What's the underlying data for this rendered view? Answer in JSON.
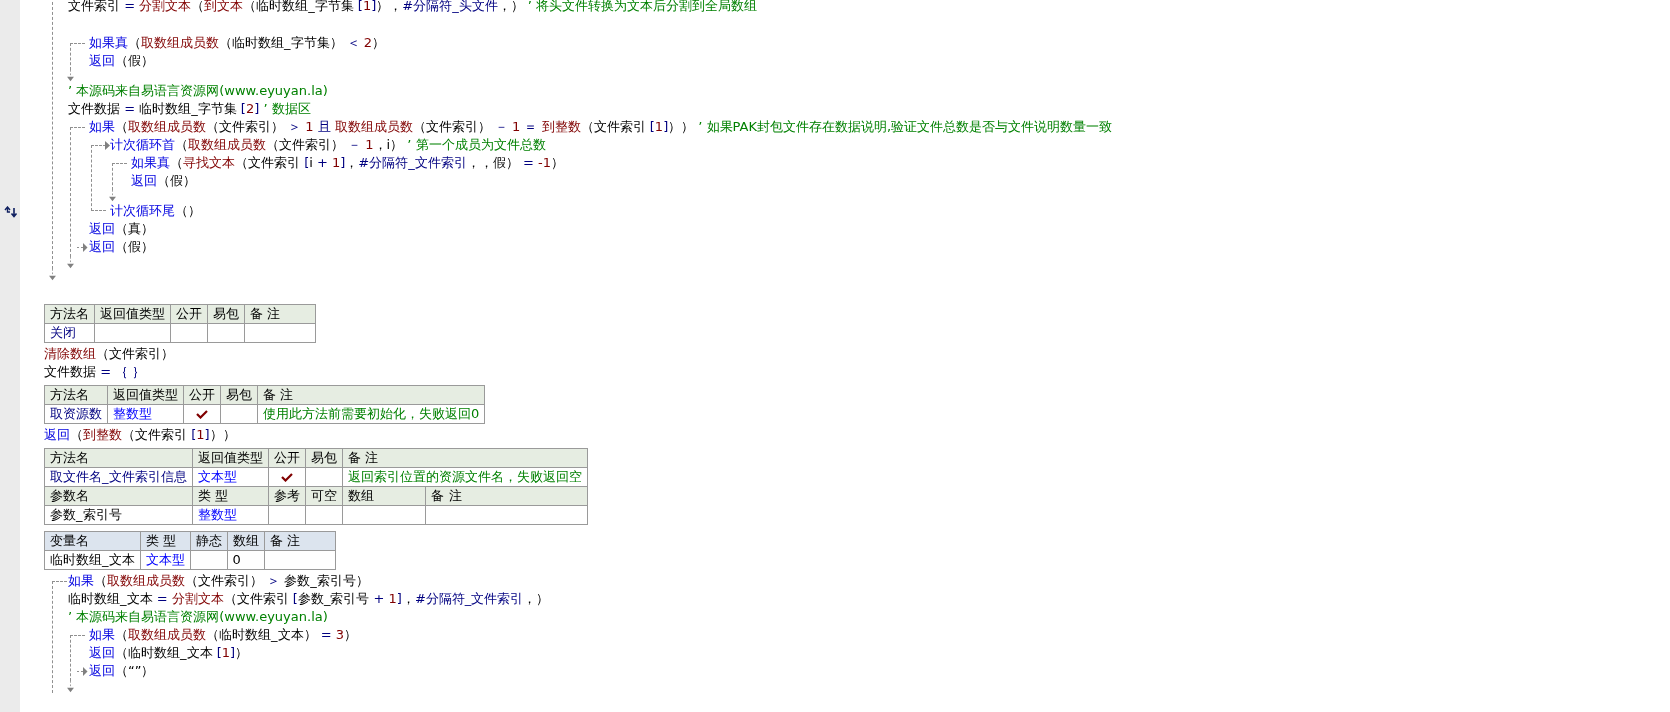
{
  "code": [
    {
      "kind": "body",
      "children": [
        {
          "kind": "line",
          "tokens": [
            {
              "kind": "plain",
              "text": "文件索引 "
            },
            {
              "kind": "op",
              "text": "= "
            },
            {
              "kind": "cmd",
              "text": "分割文本"
            },
            {
              "kind": "plain",
              "text": "（"
            },
            {
              "kind": "cmd",
              "text": "到文本"
            },
            {
              "kind": "plain",
              "text": "（临时数组_字节集 "
            },
            {
              "kind": "op",
              "text": "["
            },
            {
              "kind": "num",
              "text": "1"
            },
            {
              "kind": "op",
              "text": "]"
            },
            {
              "kind": "plain",
              "text": "），"
            },
            {
              "kind": "op",
              "text": "#分隔符_头文件"
            },
            {
              "kind": "plain",
              "text": "，）"
            },
            {
              "kind": "note",
              "text": " ’ 将头文件转换为文本后分割到全局数组"
            }
          ]
        },
        {
          "kind": "blank"
        },
        {
          "kind": "if_true",
          "head": {
            "tokens": [
              {
                "kind": "kw",
                "text": "如果真"
              },
              {
                "kind": "plain",
                "text": "（"
              },
              {
                "kind": "cmd",
                "text": "取数组成员数"
              },
              {
                "kind": "plain",
                "text": "（临时数组_字节集）"
              },
              {
                "kind": "op",
                "text": " ＜ "
              },
              {
                "kind": "num",
                "text": "2"
              },
              {
                "kind": "plain",
                "text": "）"
              }
            ]
          },
          "children": [
            {
              "kind": "line",
              "tokens": [
                {
                  "kind": "kw",
                  "text": "返回"
                },
                {
                  "kind": "plain",
                  "text": "（假）"
                }
              ]
            }
          ]
        },
        {
          "kind": "line",
          "tokens": [
            {
              "kind": "note",
              "text": "’ 本源码来自易语言资源网(www.eyuyan.la)"
            }
          ]
        },
        {
          "kind": "line",
          "tokens": [
            {
              "kind": "plain",
              "text": "文件数据 "
            },
            {
              "kind": "op",
              "text": "= "
            },
            {
              "kind": "plain",
              "text": "临时数组_字节集 "
            },
            {
              "kind": "op",
              "text": "["
            },
            {
              "kind": "num",
              "text": "2"
            },
            {
              "kind": "op",
              "text": "]"
            },
            {
              "kind": "note",
              "text": " ’ 数据区"
            }
          ]
        },
        {
          "kind": "if",
          "head": {
            "tokens": [
              {
                "kind": "kw",
                "text": "如果"
              },
              {
                "kind": "plain",
                "text": "（"
              },
              {
                "kind": "cmd",
                "text": "取数组成员数"
              },
              {
                "kind": "plain",
                "text": "（文件索引）"
              },
              {
                "kind": "op",
                "text": " ＞ "
              },
              {
                "kind": "num",
                "text": "1"
              },
              {
                "kind": "op",
                "text": " 且 "
              },
              {
                "kind": "cmd",
                "text": "取数组成员数"
              },
              {
                "kind": "plain",
                "text": "（文件索引）"
              },
              {
                "kind": "op",
                "text": " － "
              },
              {
                "kind": "num",
                "text": "1"
              },
              {
                "kind": "op",
                "text": " ＝ "
              },
              {
                "kind": "cmd",
                "text": "到整数"
              },
              {
                "kind": "plain",
                "text": "（文件索引 "
              },
              {
                "kind": "op",
                "text": "["
              },
              {
                "kind": "num",
                "text": "1"
              },
              {
                "kind": "op",
                "text": "]"
              },
              {
                "kind": "plain",
                "text": "））"
              },
              {
                "kind": "note",
                "text": " ’ 如果PAK封包文件存在数据说明,验证文件总数是否与文件说明数量一致"
              }
            ]
          },
          "children": [
            {
              "kind": "loop",
              "head": {
                "tokens": [
                  {
                    "kind": "kw",
                    "text": "计次循环首"
                  },
                  {
                    "kind": "plain",
                    "text": "（"
                  },
                  {
                    "kind": "cmd",
                    "text": "取数组成员数"
                  },
                  {
                    "kind": "plain",
                    "text": "（文件索引）"
                  },
                  {
                    "kind": "op",
                    "text": " － "
                  },
                  {
                    "kind": "num",
                    "text": "1"
                  },
                  {
                    "kind": "plain",
                    "text": "，i）"
                  },
                  {
                    "kind": "note",
                    "text": " ’ 第一个成员为文件总数"
                  }
                ]
              },
              "children": [
                {
                  "kind": "if_true",
                  "head": {
                    "tokens": [
                      {
                        "kind": "kw",
                        "text": "如果真"
                      },
                      {
                        "kind": "plain",
                        "text": "（"
                      },
                      {
                        "kind": "cmd",
                        "text": "寻找文本"
                      },
                      {
                        "kind": "plain",
                        "text": "（文件索引 "
                      },
                      {
                        "kind": "op",
                        "text": "["
                      },
                      {
                        "kind": "plain",
                        "text": "i "
                      },
                      {
                        "kind": "op",
                        "text": "+ "
                      },
                      {
                        "kind": "num",
                        "text": "1"
                      },
                      {
                        "kind": "op",
                        "text": "]"
                      },
                      {
                        "kind": "plain",
                        "text": "，"
                      },
                      {
                        "kind": "op",
                        "text": "#分隔符_文件索引"
                      },
                      {
                        "kind": "plain",
                        "text": "，，假）"
                      },
                      {
                        "kind": "op",
                        "text": " = "
                      },
                      {
                        "kind": "num",
                        "text": "-1"
                      },
                      {
                        "kind": "plain",
                        "text": "）"
                      }
                    ]
                  },
                  "children": [
                    {
                      "kind": "line",
                      "tokens": [
                        {
                          "kind": "kw",
                          "text": "返回"
                        },
                        {
                          "kind": "plain",
                          "text": "（假）"
                        }
                      ]
                    }
                  ]
                }
              ],
              "tail": {
                "tokens": [
                  {
                    "kind": "kw",
                    "text": "计次循环尾"
                  },
                  {
                    "kind": "plain",
                    "text": "（）"
                  }
                ],
                "gutter_mark": true
              }
            },
            {
              "kind": "line",
              "tokens": [
                {
                  "kind": "kw",
                  "text": "返回"
                },
                {
                  "kind": "plain",
                  "text": "（真）"
                }
              ]
            }
          ],
          "else": [
            {
              "kind": "line",
              "tokens": [
                {
                  "kind": "kw",
                  "text": "返回"
                },
                {
                  "kind": "plain",
                  "text": "（假）"
                }
              ]
            }
          ]
        }
      ]
    },
    {
      "kind": "blank"
    },
    {
      "kind": "method_table",
      "rows": [
        {
          "kind": "header",
          "cells": [
            {
              "kind": "plain",
              "text": "方法名"
            },
            {
              "kind": "plain",
              "text": "返回值类型"
            },
            {
              "kind": "plain",
              "text": "公开"
            },
            {
              "kind": "plain",
              "text": "易包"
            },
            {
              "kind": "plain",
              "text": "备 注"
            }
          ]
        },
        {
          "kind": "data",
          "cells": [
            {
              "kind": "name",
              "text": "关闭"
            },
            {
              "kind": "empty"
            },
            {
              "kind": "empty"
            },
            {
              "kind": "empty"
            },
            {
              "kind": "empty"
            }
          ]
        }
      ]
    },
    {
      "kind": "line",
      "tokens": [
        {
          "kind": "cmd",
          "text": "清除数组"
        },
        {
          "kind": "plain",
          "text": "（文件索引）"
        }
      ]
    },
    {
      "kind": "line",
      "tokens": [
        {
          "kind": "plain",
          "text": "文件数据 "
        },
        {
          "kind": "op",
          "text": "= ｛ ｝"
        }
      ]
    },
    {
      "kind": "method_table",
      "rows": [
        {
          "kind": "header",
          "cells": [
            {
              "kind": "plain",
              "text": "方法名"
            },
            {
              "kind": "plain",
              "text": "返回值类型"
            },
            {
              "kind": "plain",
              "text": "公开"
            },
            {
              "kind": "plain",
              "text": "易包"
            },
            {
              "kind": "plain",
              "text": "备 注"
            }
          ]
        },
        {
          "kind": "data",
          "cells": [
            {
              "kind": "name",
              "text": "取资源数"
            },
            {
              "kind": "type",
              "text": "整数型"
            },
            {
              "kind": "check",
              "checked": true
            },
            {
              "kind": "empty"
            },
            {
              "kind": "note",
              "text": "使用此方法前需要初始化，失败返回0"
            }
          ]
        }
      ]
    },
    {
      "kind": "line",
      "tokens": [
        {
          "kind": "kw",
          "text": "返回"
        },
        {
          "kind": "plain",
          "text": "（"
        },
        {
          "kind": "cmd",
          "text": "到整数"
        },
        {
          "kind": "plain",
          "text": "（文件索引 "
        },
        {
          "kind": "op",
          "text": "["
        },
        {
          "kind": "num",
          "text": "1"
        },
        {
          "kind": "op",
          "text": "]"
        },
        {
          "kind": "plain",
          "text": "））"
        }
      ]
    },
    {
      "kind": "method_table",
      "rows": [
        {
          "kind": "header",
          "cells": [
            {
              "kind": "plain",
              "text": "方法名"
            },
            {
              "kind": "plain",
              "text": "返回值类型"
            },
            {
              "kind": "plain",
              "text": "公开"
            },
            {
              "kind": "plain",
              "text": "易包"
            },
            {
              "kind": "plain",
              "text": "备 注"
            }
          ]
        },
        {
          "kind": "data",
          "cells": [
            {
              "kind": "name",
              "text": "取文件名_文件索引信息"
            },
            {
              "kind": "type",
              "text": "文本型"
            },
            {
              "kind": "check",
              "checked": true
            },
            {
              "kind": "empty"
            },
            {
              "kind": "note",
              "text": "返回索引位置的资源文件名，失败返回空"
            }
          ]
        }
      ],
      "params": [
        {
          "kind": "header",
          "cells": [
            {
              "kind": "plain",
              "text": "参数名"
            },
            {
              "kind": "plain",
              "text": "类 型"
            },
            {
              "kind": "plain",
              "text": "参考"
            },
            {
              "kind": "plain",
              "text": "可空"
            },
            {
              "kind": "plain",
              "text": "数组"
            },
            {
              "kind": "plain",
              "text": "备 注"
            }
          ]
        },
        {
          "kind": "data",
          "cells": [
            {
              "kind": "plain",
              "text": "参数_索引号"
            },
            {
              "kind": "type",
              "text": "整数型"
            },
            {
              "kind": "empty"
            },
            {
              "kind": "empty"
            },
            {
              "kind": "empty"
            },
            {
              "kind": "empty"
            }
          ]
        }
      ]
    },
    {
      "kind": "var_table",
      "rows": [
        {
          "kind": "header",
          "cells": [
            {
              "kind": "plain",
              "text": "变量名"
            },
            {
              "kind": "plain",
              "text": "类 型"
            },
            {
              "kind": "plain",
              "text": "静态"
            },
            {
              "kind": "plain",
              "text": "数组"
            },
            {
              "kind": "plain",
              "text": "备 注"
            }
          ]
        },
        {
          "kind": "data",
          "cells": [
            {
              "kind": "plain",
              "text": "临时数组_文本"
            },
            {
              "kind": "type",
              "text": "文本型"
            },
            {
              "kind": "empty"
            },
            {
              "kind": "plain",
              "text": "0"
            },
            {
              "kind": "empty"
            }
          ]
        }
      ]
    },
    {
      "kind": "if",
      "continues": true,
      "head": {
        "tokens": [
          {
            "kind": "kw",
            "text": "如果"
          },
          {
            "kind": "plain",
            "text": "（"
          },
          {
            "kind": "cmd",
            "text": "取数组成员数"
          },
          {
            "kind": "plain",
            "text": "（文件索引）"
          },
          {
            "kind": "op",
            "text": " ＞ "
          },
          {
            "kind": "plain",
            "text": "参数_索引号）"
          }
        ]
      },
      "children": [
        {
          "kind": "line",
          "tokens": [
            {
              "kind": "plain",
              "text": "临时数组_文本 "
            },
            {
              "kind": "op",
              "text": "= "
            },
            {
              "kind": "cmd",
              "text": "分割文本"
            },
            {
              "kind": "plain",
              "text": "（文件索引 "
            },
            {
              "kind": "op",
              "text": "["
            },
            {
              "kind": "plain",
              "text": "参数_索引号 "
            },
            {
              "kind": "op",
              "text": "+ "
            },
            {
              "kind": "num",
              "text": "1"
            },
            {
              "kind": "op",
              "text": "]"
            },
            {
              "kind": "plain",
              "text": "，"
            },
            {
              "kind": "op",
              "text": "#分隔符_文件索引"
            },
            {
              "kind": "plain",
              "text": "，）"
            }
          ]
        },
        {
          "kind": "line",
          "tokens": [
            {
              "kind": "note",
              "text": "’ 本源码来自易语言资源网(www.eyuyan.la)"
            }
          ]
        },
        {
          "kind": "if",
          "head": {
            "tokens": [
              {
                "kind": "kw",
                "text": "如果"
              },
              {
                "kind": "plain",
                "text": "（"
              },
              {
                "kind": "cmd",
                "text": "取数组成员数"
              },
              {
                "kind": "plain",
                "text": "（临时数组_文本）"
              },
              {
                "kind": "op",
                "text": " = "
              },
              {
                "kind": "num",
                "text": "3"
              },
              {
                "kind": "plain",
                "text": "）"
              }
            ]
          },
          "children": [
            {
              "kind": "line",
              "tokens": [
                {
                  "kind": "kw",
                  "text": "返回"
                },
                {
                  "kind": "plain",
                  "text": "（临时数组_文本 "
                },
                {
                  "kind": "op",
                  "text": "["
                },
                {
                  "kind": "num",
                  "text": "1"
                },
                {
                  "kind": "op",
                  "text": "]"
                },
                {
                  "kind": "plain",
                  "text": "）"
                }
              ]
            }
          ],
          "else": [
            {
              "kind": "line",
              "tokens": [
                {
                  "kind": "kw",
                  "text": "返回"
                },
                {
                  "kind": "plain",
                  "text": "（“”）"
                }
              ]
            }
          ]
        }
      ]
    }
  ]
}
